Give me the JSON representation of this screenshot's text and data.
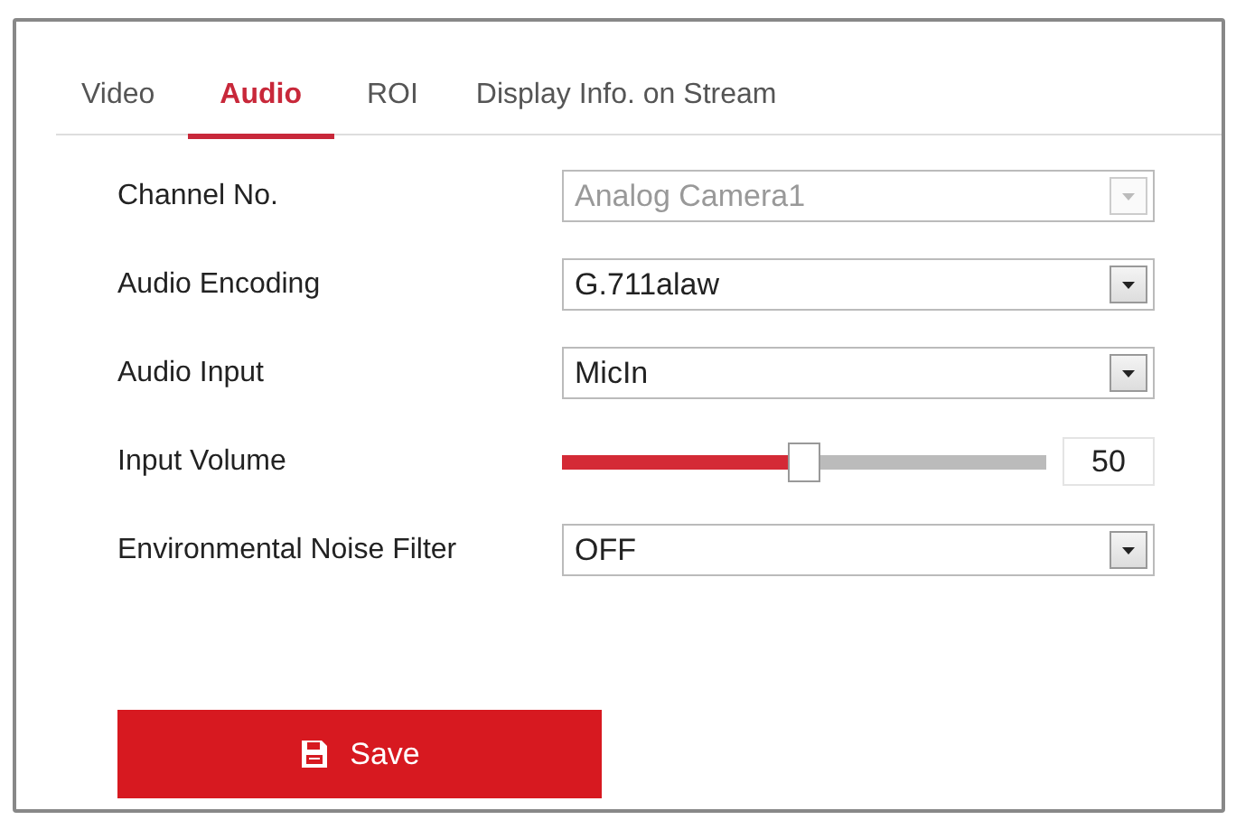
{
  "tabs": [
    {
      "label": "Video",
      "selected": false
    },
    {
      "label": "Audio",
      "selected": true
    },
    {
      "label": "ROI",
      "selected": false
    },
    {
      "label": "Display Info. on Stream",
      "selected": false
    }
  ],
  "fields": [
    {
      "kind": "select",
      "label": "Channel No.",
      "value": "Analog Camera1",
      "disabled": true
    },
    {
      "kind": "select",
      "label": "Audio Encoding",
      "value": "G.711alaw",
      "disabled": false
    },
    {
      "kind": "select",
      "label": "Audio Input",
      "value": "MicIn",
      "disabled": false
    },
    {
      "kind": "slider",
      "label": "Input Volume",
      "level": 0.5,
      "reading": "50"
    },
    {
      "kind": "select",
      "label": "Environmental Noise Filter",
      "value": "OFF",
      "disabled": false
    }
  ],
  "save_button": {
    "label": "Save"
  }
}
